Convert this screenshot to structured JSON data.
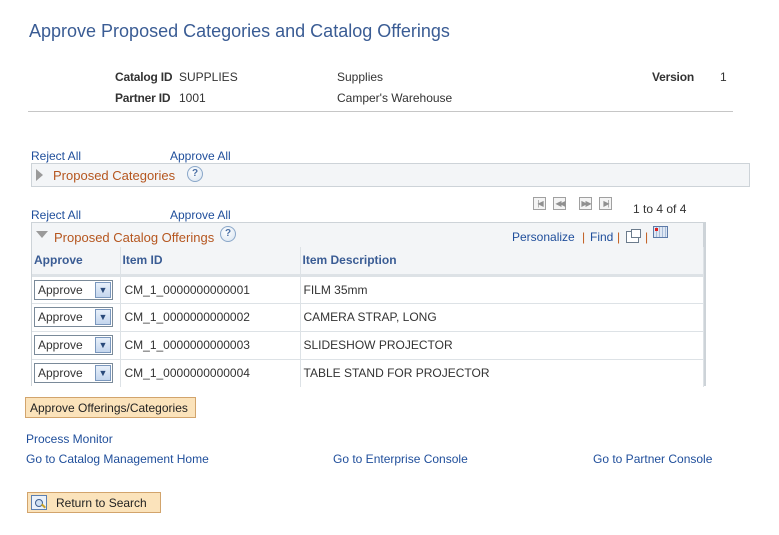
{
  "page": {
    "title": "Approve Proposed Categories and Catalog Offerings"
  },
  "header": {
    "catalog_id_label": "Catalog ID",
    "catalog_id_value": "SUPPLIES",
    "catalog_desc": "Supplies",
    "version_label": "Version",
    "version_value": "1",
    "partner_id_label": "Partner ID",
    "partner_id_value": "1001",
    "partner_name": "Camper's Warehouse"
  },
  "categories_section": {
    "reject_all": "Reject All",
    "approve_all": "Approve All",
    "title": "Proposed Categories",
    "help": "?",
    "expanded": false
  },
  "offerings_section": {
    "reject_all": "Reject All",
    "approve_all": "Approve All",
    "title": "Proposed Catalog Offerings",
    "help": "?",
    "expanded": true,
    "nav": {
      "first": "first-icon",
      "previous": "previous-icon",
      "next": "next-icon",
      "last": "last-icon",
      "counter": "1 to 4 of 4"
    },
    "toolbar": {
      "personalize": "Personalize",
      "find": "Find",
      "separator": "|",
      "zoom_icon": "view-all-icon",
      "download_icon": "download-icon"
    },
    "columns": [
      "Approve",
      "Item ID",
      "Item Description"
    ],
    "rows": [
      {
        "approve": "Approve",
        "item_id": "CM_1_0000000000001",
        "description": "FILM 35mm"
      },
      {
        "approve": "Approve",
        "item_id": "CM_1_0000000000002",
        "description": "CAMERA STRAP, LONG"
      },
      {
        "approve": "Approve",
        "item_id": "CM_1_0000000000003",
        "description": "SLIDESHOW PROJECTOR"
      },
      {
        "approve": "Approve",
        "item_id": "CM_1_0000000000004",
        "description": "TABLE STAND FOR PROJECTOR"
      }
    ]
  },
  "actions": {
    "approve_button": "Approve Offerings/Categories",
    "process_monitor": "Process Monitor",
    "catalog_home": "Go to Catalog Management Home",
    "enterprise_console": "Go to Enterprise Console",
    "partner_console": "Go to Partner Console",
    "return_to_search": "Return to Search"
  },
  "colors": {
    "title": "#3a5c94",
    "link": "#1f4e9b",
    "section_title": "#b5561f",
    "button_bg": "#fbe3bb",
    "button_border": "#d2a46c"
  }
}
